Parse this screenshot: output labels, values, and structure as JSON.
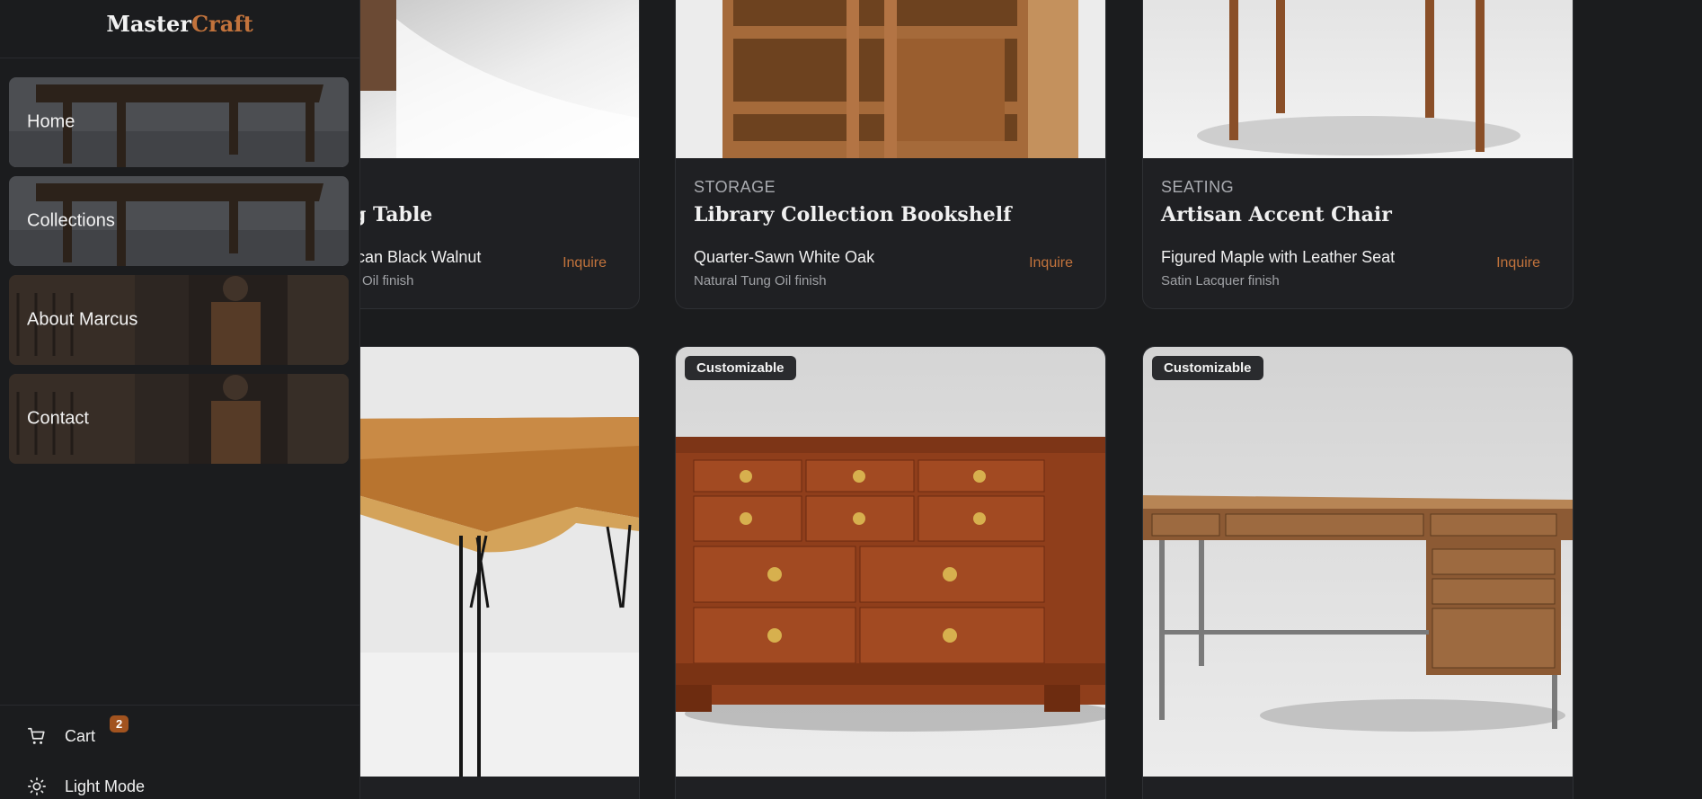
{
  "brand": {
    "name_part1": "Master",
    "name_part2": "Craft"
  },
  "nav": [
    {
      "label": "Home"
    },
    {
      "label": "Collections"
    },
    {
      "label": "About Marcus"
    },
    {
      "label": "Contact"
    }
  ],
  "footer": {
    "cart_label": "Cart",
    "cart_count": "2",
    "theme_label": "Light Mode"
  },
  "products": [
    {
      "category": "",
      "name": "ng Table",
      "material": "can Black Walnut",
      "finish": "Oil finish",
      "action": "Inquire"
    },
    {
      "category": "STORAGE",
      "name": "Library Collection Bookshelf",
      "material": "Quarter-Sawn White Oak",
      "finish": "Natural Tung Oil finish",
      "action": "Inquire"
    },
    {
      "category": "SEATING",
      "name": "Artisan Accent Chair",
      "material": "Figured Maple with Leather Seat",
      "finish": "Satin Lacquer finish",
      "action": "Inquire"
    },
    {
      "badge": ""
    },
    {
      "badge": "Customizable"
    },
    {
      "badge": "Customizable"
    }
  ],
  "colors": {
    "accent": "#c2733c",
    "background": "#1b1c1e",
    "card": "#1f2023"
  }
}
